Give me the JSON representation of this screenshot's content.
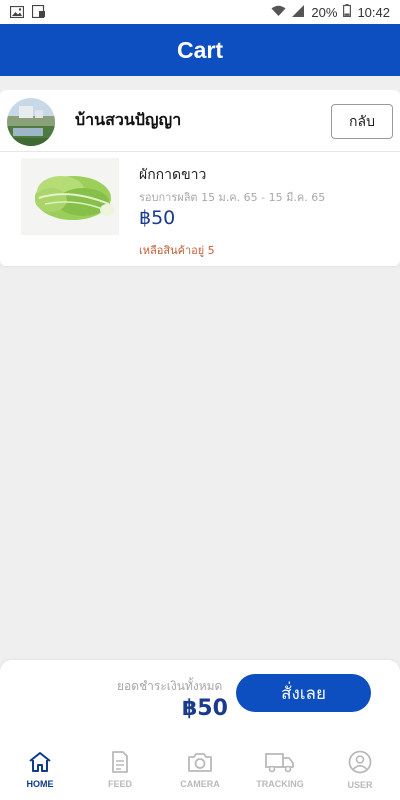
{
  "status_bar": {
    "battery_percent": "20%",
    "time": "10:42"
  },
  "app_bar": {
    "title": "Cart"
  },
  "store": {
    "name": "บ้านสวนปัญญา",
    "back_label": "กลับ"
  },
  "cart_items": [
    {
      "name": "ผักกาดขาว",
      "round": "รอบการผลิต 15 ม.ค. 65 - 15 มี.ค. 65",
      "price": "฿50",
      "stock": "เหลือสินค้าอยู่ 5"
    }
  ],
  "checkout": {
    "total_label": "ยอดชำระเงินทั้งหมด",
    "total_value": "฿50",
    "order_label": "สั่งเลย"
  },
  "nav": {
    "home": "HOME",
    "feed": "FEED",
    "camera": "CAMERA",
    "tracking": "TRACKING",
    "user": "USER"
  },
  "colors": {
    "primary": "#0d4fc0",
    "price": "#1a3a8c",
    "stock": "#c0603a"
  }
}
